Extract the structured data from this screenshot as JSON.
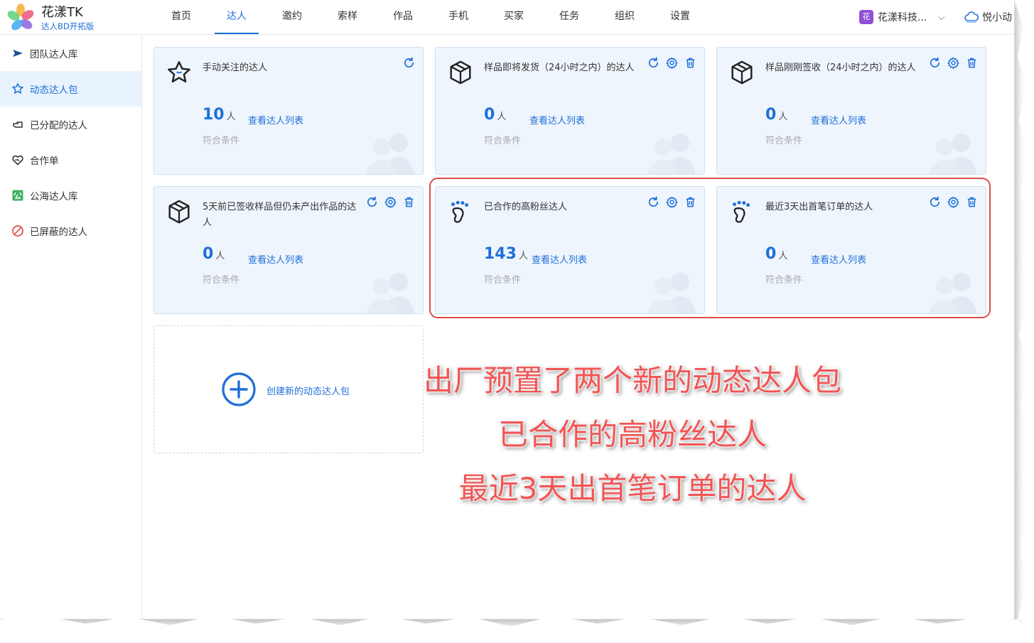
{
  "app": {
    "title": "花漾TK",
    "subtitle": "达人BD开拓版"
  },
  "nav": [
    {
      "label": "首页",
      "active": false
    },
    {
      "label": "达人",
      "active": true
    },
    {
      "label": "邀约",
      "active": false
    },
    {
      "label": "索样",
      "active": false
    },
    {
      "label": "作品",
      "active": false
    },
    {
      "label": "手机",
      "active": false
    },
    {
      "label": "买家",
      "active": false
    },
    {
      "label": "任务",
      "active": false
    },
    {
      "label": "组织",
      "active": false
    },
    {
      "label": "设置",
      "active": false
    }
  ],
  "org": {
    "badge": "花",
    "name": "花漾科技..."
  },
  "user": {
    "name": "悦小动"
  },
  "sidebar": {
    "items": [
      {
        "label": "团队达人库",
        "icon": "plane-icon"
      },
      {
        "label": "动态达人包",
        "icon": "star-icon"
      },
      {
        "label": "已分配的达人",
        "icon": "hand-point-icon"
      },
      {
        "label": "合作单",
        "icon": "handshake-heart-icon"
      },
      {
        "label": "公海达人库",
        "icon": "public-badge-icon"
      },
      {
        "label": "已屏蔽的达人",
        "icon": "ban-icon"
      }
    ],
    "active_index": 1
  },
  "cards": [
    {
      "title": "手动关注的达人",
      "count": "10",
      "unit": "人",
      "link": "查看达人列表",
      "meet": "符合条件",
      "icon": "star-outline-icon"
    },
    {
      "title": "样品即将发货（24小时之内）的达人",
      "count": "0",
      "unit": "人",
      "link": "查看达人列表",
      "meet": "符合条件",
      "icon": "package-icon"
    },
    {
      "title": "样品刚刚签收（24小时之内）的达人",
      "count": "0",
      "unit": "人",
      "link": "查看达人列表",
      "meet": "符合条件",
      "icon": "package-icon"
    },
    {
      "title": "5天前已签收样品但仍未产出作品的达人",
      "count": "0",
      "unit": "人",
      "link": "查看达人列表",
      "meet": "符合条件",
      "icon": "package-icon"
    },
    {
      "title": "已合作的高粉丝达人",
      "count": "143",
      "unit": "人",
      "link": "查看达人列表",
      "meet": "符合条件",
      "icon": "footprint-icon"
    },
    {
      "title": "最近3天出首笔订单的达人",
      "count": "0",
      "unit": "人",
      "link": "查看达人列表",
      "meet": "符合条件",
      "icon": "footprint-icon"
    }
  ],
  "create": {
    "label": "创建新的动态达人包"
  },
  "annotation": {
    "line1": "出厂预置了两个新的动态达人包",
    "line2": "已合作的高粉丝达人",
    "line3": "最近3天出首笔订单的达人"
  },
  "colors": {
    "accent": "#1e6fd9",
    "card_bg": "#eef5fd",
    "highlight": "#e24a4a",
    "annotation": "#f25555"
  }
}
